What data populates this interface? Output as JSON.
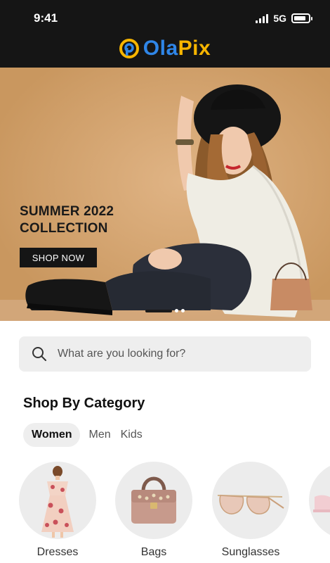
{
  "status": {
    "time": "9:41",
    "network": "5G"
  },
  "brand": {
    "part1": "Ola",
    "part2": "Pix"
  },
  "hero": {
    "title": "SUMMER 2022\nCOLLECTION",
    "button": "SHOP NOW"
  },
  "search": {
    "placeholder": "What are you looking for?"
  },
  "category": {
    "title": "Shop By Category",
    "tabs": [
      "Women",
      "Men",
      "Kids"
    ],
    "items": [
      "Dresses",
      "Bags",
      "Sunglasses"
    ]
  }
}
